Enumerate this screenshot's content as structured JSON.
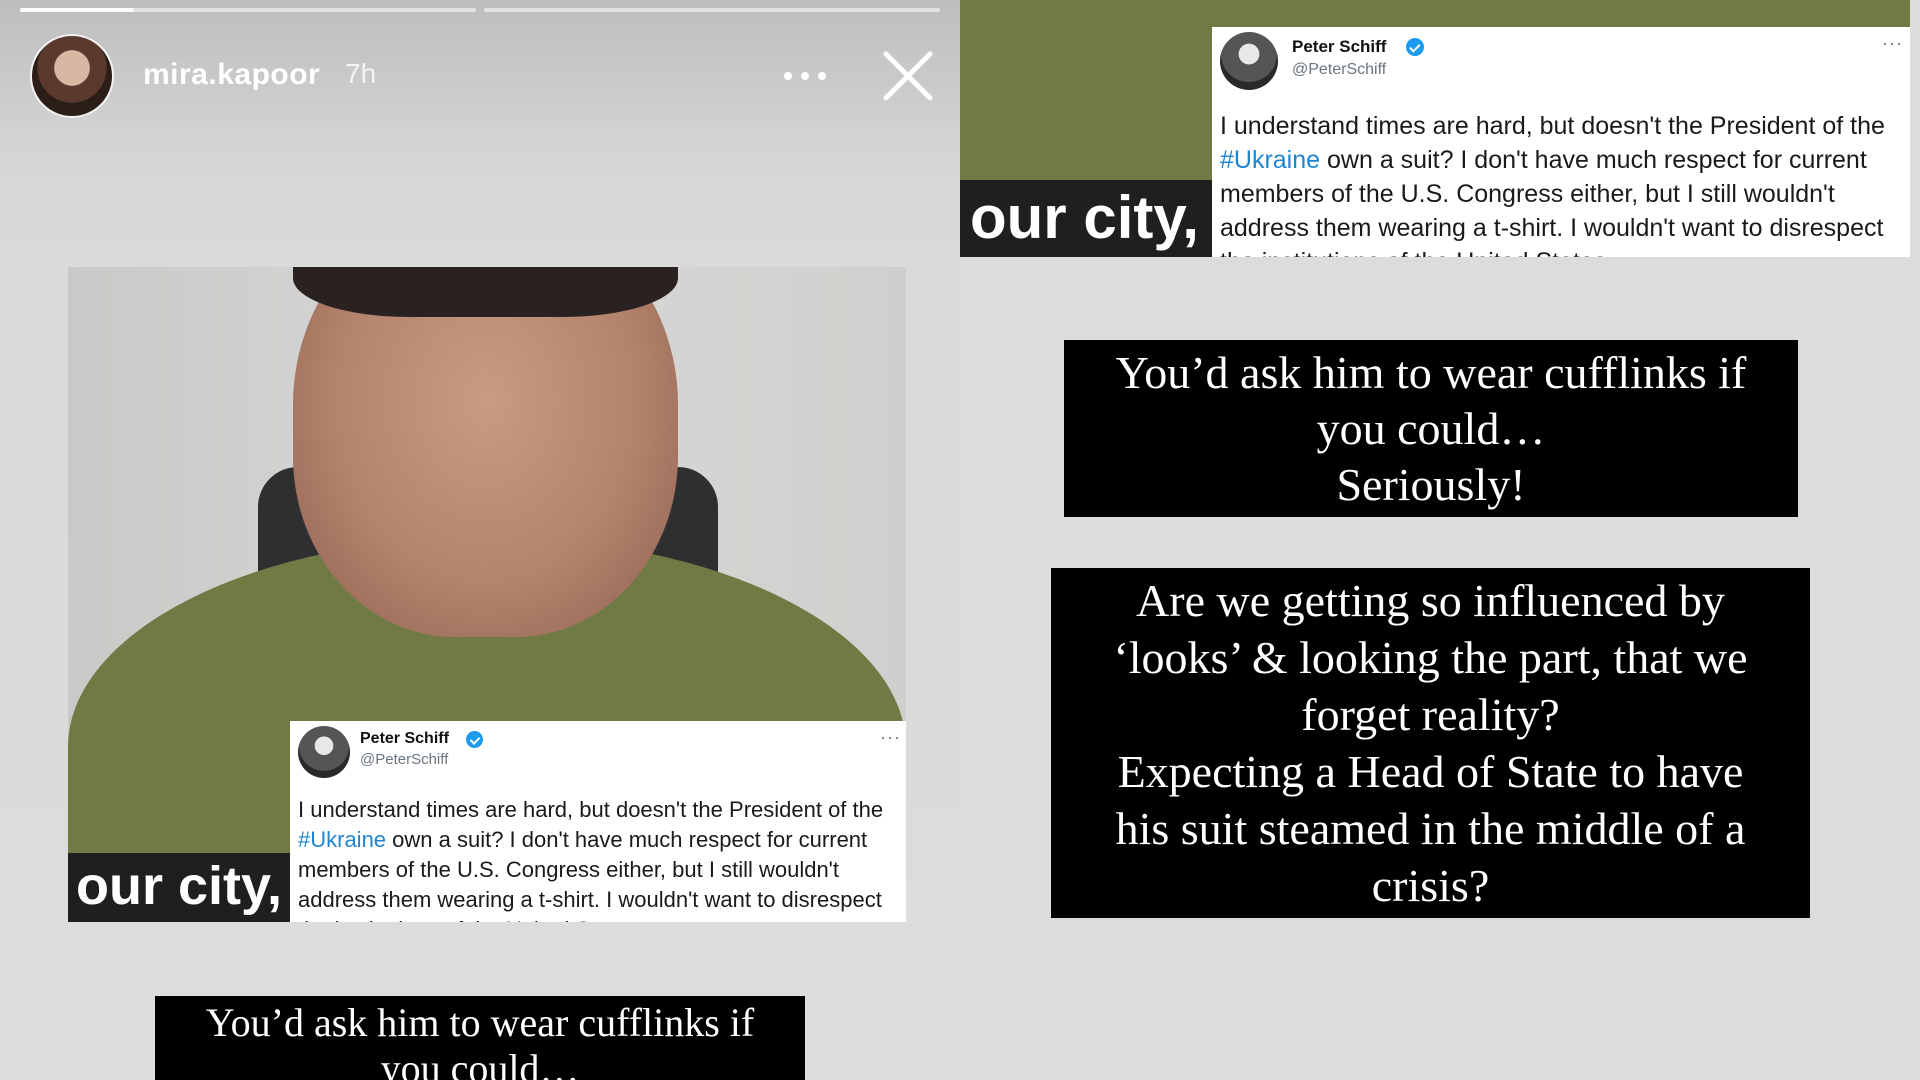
{
  "story": {
    "username": "mira.kapoor",
    "time_ago": "7h",
    "progress": [
      {
        "fill": 0.25
      },
      {
        "fill": 0
      }
    ]
  },
  "video": {
    "caption": "our city,"
  },
  "tweet": {
    "name": "Peter Schiff",
    "handle": "@PeterSchiff",
    "more": "···",
    "text_before": "I understand times are hard, but doesn't the President of the ",
    "hashtag": "#Ukraine",
    "text_after": " own a suit? I don't have much respect for current members of the U.S. Congress either, but I still wouldn't address them wearing a t-shirt. I wouldn't want to disrespect the institutions of the United States."
  },
  "text_blocks": {
    "cufflinks": {
      "lines": [
        "You’d ask him to wear cufflinks if",
        "you could…",
        "Seriously!"
      ],
      "left_visible_lines": [
        "You’d ask him to wear cufflinks if",
        "you could…"
      ]
    },
    "influenced": {
      "lines": [
        "Are we getting so influenced by",
        "‘looks’ & looking the part, that we",
        "forget reality?",
        "Expecting a Head of State to have",
        "his suit steamed in the middle of a",
        "crisis?"
      ]
    }
  },
  "colors": {
    "hashtag": "#1d86cf",
    "verified_badge": "#1d9bf0",
    "shirt": "#6f7a44",
    "block_bg": "#000000"
  }
}
